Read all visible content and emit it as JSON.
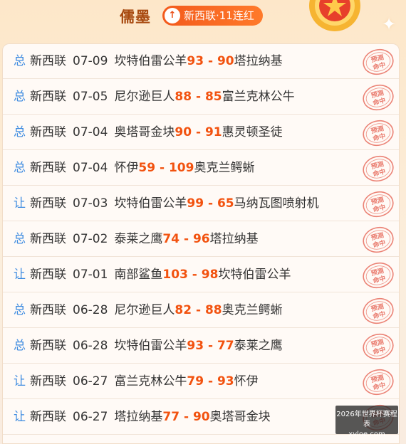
{
  "header": {
    "expert_name": "儒墨",
    "streak_label": "新西联·11连红",
    "streak_icon": "arrow-up-icon"
  },
  "stamp_text": "预测命中",
  "predictions": [
    {
      "type": "总",
      "league": "新西联",
      "date": "07-09",
      "home": "坎特伯雷公羊",
      "score": "93 - 90",
      "away": "塔拉纳基"
    },
    {
      "type": "总",
      "league": "新西联",
      "date": "07-05",
      "home": "尼尔逊巨人",
      "score": "88 - 85",
      "away": "富兰克林公牛"
    },
    {
      "type": "总",
      "league": "新西联",
      "date": "07-04",
      "home": "奥塔哥金块",
      "score": "90 - 91",
      "away": "惠灵顿圣徒"
    },
    {
      "type": "总",
      "league": "新西联",
      "date": "07-04",
      "home": "怀伊",
      "score": "59 - 109",
      "away": "奥克兰鳄蜥"
    },
    {
      "type": "让",
      "league": "新西联",
      "date": "07-03",
      "home": "坎特伯雷公羊",
      "score": "99 - 65",
      "away": "马纳瓦图喷射机"
    },
    {
      "type": "总",
      "league": "新西联",
      "date": "07-02",
      "home": "泰莱之鹰",
      "score": "74 - 96",
      "away": "塔拉纳基"
    },
    {
      "type": "让",
      "league": "新西联",
      "date": "07-01",
      "home": "南部鲨鱼",
      "score": "103 - 98",
      "away": "坎特伯雷公羊"
    },
    {
      "type": "总",
      "league": "新西联",
      "date": "06-28",
      "home": "尼尔逊巨人",
      "score": "82 - 88",
      "away": "奥克兰鳄蜥"
    },
    {
      "type": "总",
      "league": "新西联",
      "date": "06-28",
      "home": "坎特伯雷公羊",
      "score": "93 - 77",
      "away": "泰莱之鹰"
    },
    {
      "type": "让",
      "league": "新西联",
      "date": "06-27",
      "home": "富兰克林公牛",
      "score": "79 - 93",
      "away": "怀伊"
    },
    {
      "type": "让",
      "league": "新西联",
      "date": "06-27",
      "home": "塔拉纳基",
      "score": "77 - 90",
      "away": "奥塔哥金块"
    }
  ],
  "watermark": {
    "line1": "2026年世界杯赛程表",
    "line2": "xvloe.com"
  },
  "colors": {
    "accent": "#f2520f",
    "play_type": "#3d8be0",
    "stamp": "#e45a4a"
  }
}
